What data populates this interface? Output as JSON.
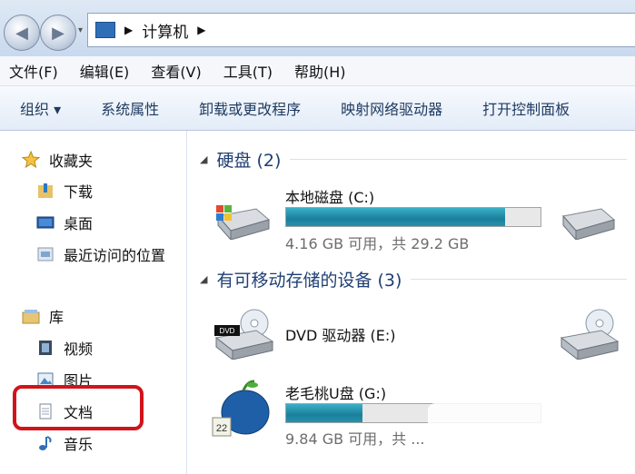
{
  "address": {
    "path": "计算机"
  },
  "menu": [
    "文件(F)",
    "编辑(E)",
    "查看(V)",
    "工具(T)",
    "帮助(H)"
  ],
  "toolbar": {
    "organize": "组织 ▾",
    "system_props": "系统属性",
    "uninstall": "卸载或更改程序",
    "map_drive": "映射网络驱动器",
    "control_panel": "打开控制面板"
  },
  "sidebar": {
    "favorites": "收藏夹",
    "downloads": "下载",
    "desktop": "桌面",
    "recent": "最近访问的位置",
    "libraries": "库",
    "videos": "视频",
    "pictures": "图片",
    "documents": "文档",
    "music": "音乐"
  },
  "groups": {
    "hdd": "硬盘 (2)",
    "removable": "有可移动存储的设备 (3)"
  },
  "drives": {
    "c": {
      "name": "本地磁盘 (C:)",
      "info": "4.16 GB 可用，共 29.2 GB",
      "used_fraction": 0.86
    },
    "dvd": {
      "name": "DVD 驱动器 (E:)"
    },
    "g": {
      "name": "老毛桃U盘 (G:)",
      "info": "9.84 GB 可用，共 ...",
      "used_fraction": 0.3
    },
    "dvd_badge": "DVD"
  },
  "colors": {
    "highlight": "#d0141a",
    "bar": "#1b7f9a",
    "group_text": "#1f3f73"
  }
}
